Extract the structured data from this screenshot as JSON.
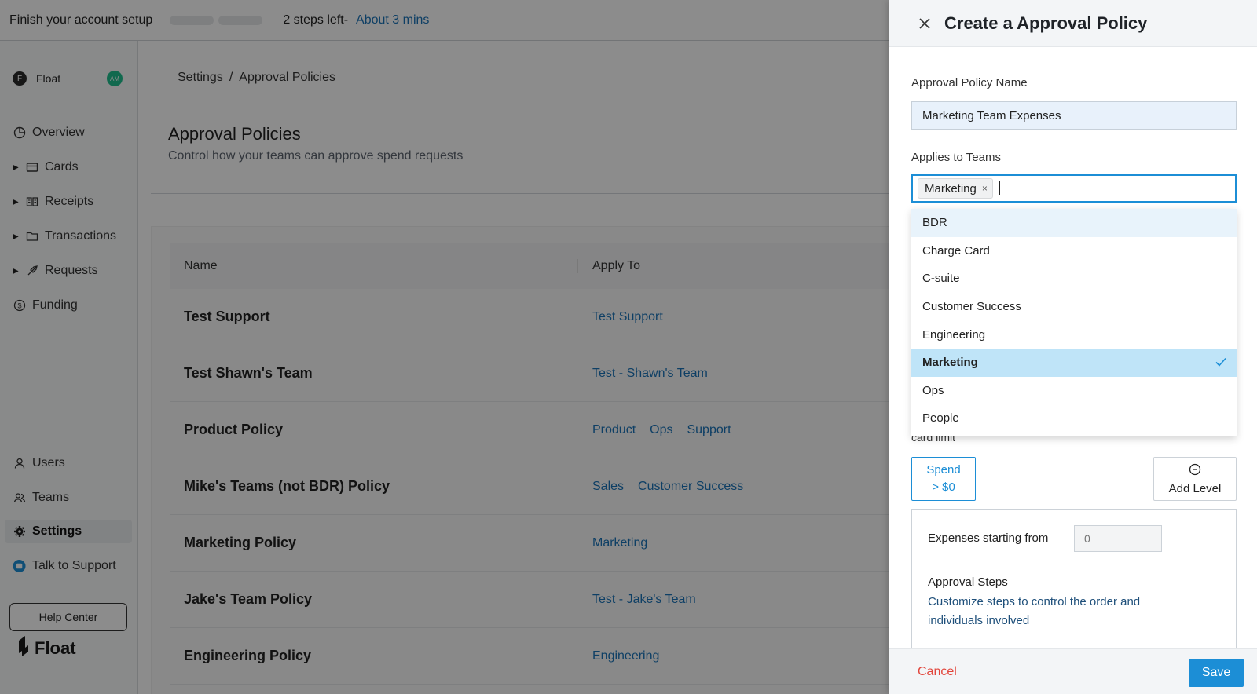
{
  "topbar": {
    "setup_text": "Finish your account setup",
    "steps_left": "2 steps left-",
    "time_estimate": "About 3 mins"
  },
  "sidebar": {
    "org_initial": "F",
    "org_name": "Float",
    "avatar_initials": "AM",
    "items": [
      {
        "label": "Overview",
        "icon": "pie-chart-icon"
      },
      {
        "label": "Cards",
        "icon": "card-icon"
      },
      {
        "label": "Receipts",
        "icon": "receipt-icon"
      },
      {
        "label": "Transactions",
        "icon": "folder-icon"
      },
      {
        "label": "Requests",
        "icon": "rocket-icon"
      },
      {
        "label": "Funding",
        "icon": "dollar-circle-icon"
      }
    ],
    "bottom_items": [
      {
        "label": "Users",
        "icon": "user-icon"
      },
      {
        "label": "Teams",
        "icon": "team-icon"
      },
      {
        "label": "Settings",
        "icon": "gear-icon"
      },
      {
        "label": "Talk to Support",
        "icon": "chat-icon"
      }
    ],
    "help_label": "Help Center",
    "brand": "Float"
  },
  "main": {
    "breadcrumb": {
      "root": "Settings",
      "sep": "/",
      "current": "Approval Policies"
    },
    "title": "Approval Policies",
    "subtitle": "Control how your teams can approve spend requests",
    "table": {
      "columns": [
        "Name",
        "Apply To"
      ],
      "rows": [
        {
          "name": "Test Support",
          "apply": [
            "Test Support"
          ]
        },
        {
          "name": "Test Shawn's Team",
          "apply": [
            "Test - Shawn's Team"
          ]
        },
        {
          "name": "Product Policy",
          "apply": [
            "Product",
            "Ops",
            "Support"
          ]
        },
        {
          "name": "Mike's Teams (not BDR) Policy",
          "apply": [
            "Sales",
            "Customer Success"
          ]
        },
        {
          "name": "Marketing Policy",
          "apply": [
            "Marketing"
          ]
        },
        {
          "name": "Jake's Team Policy",
          "apply": [
            "Test - Jake's Team"
          ]
        },
        {
          "name": "Engineering Policy",
          "apply": [
            "Engineering"
          ]
        }
      ]
    }
  },
  "drawer": {
    "title": "Create a Approval Policy",
    "name_label": "Approval Policy Name",
    "name_value": "Marketing Team Expenses",
    "teams_label": "Applies to Teams",
    "selected_chip": "Marketing",
    "chip_remove": "×",
    "options": [
      "BDR",
      "Charge Card",
      "C-suite",
      "Customer Success",
      "Engineering",
      "Marketing",
      "Ops",
      "People"
    ],
    "hovered_option": "BDR",
    "selected_option": "Marketing",
    "card_limit_text": "card limit",
    "spend_line1": "Spend",
    "spend_line2": "> $0",
    "add_level": "Add Level",
    "expenses_label": "Expenses starting from",
    "expenses_placeholder": "0",
    "steps_title": "Approval Steps",
    "steps_desc": "Customize steps to control the order and individuals involved",
    "cancel": "Cancel",
    "save": "Save"
  },
  "colors": {
    "accent": "#1c8ed6",
    "link": "#1a73b8",
    "danger": "#e2453b",
    "selected_bg": "#bfe4f8",
    "hover_bg": "#e8f3fb",
    "overlay": "rgba(0,0,0,0.45)"
  }
}
